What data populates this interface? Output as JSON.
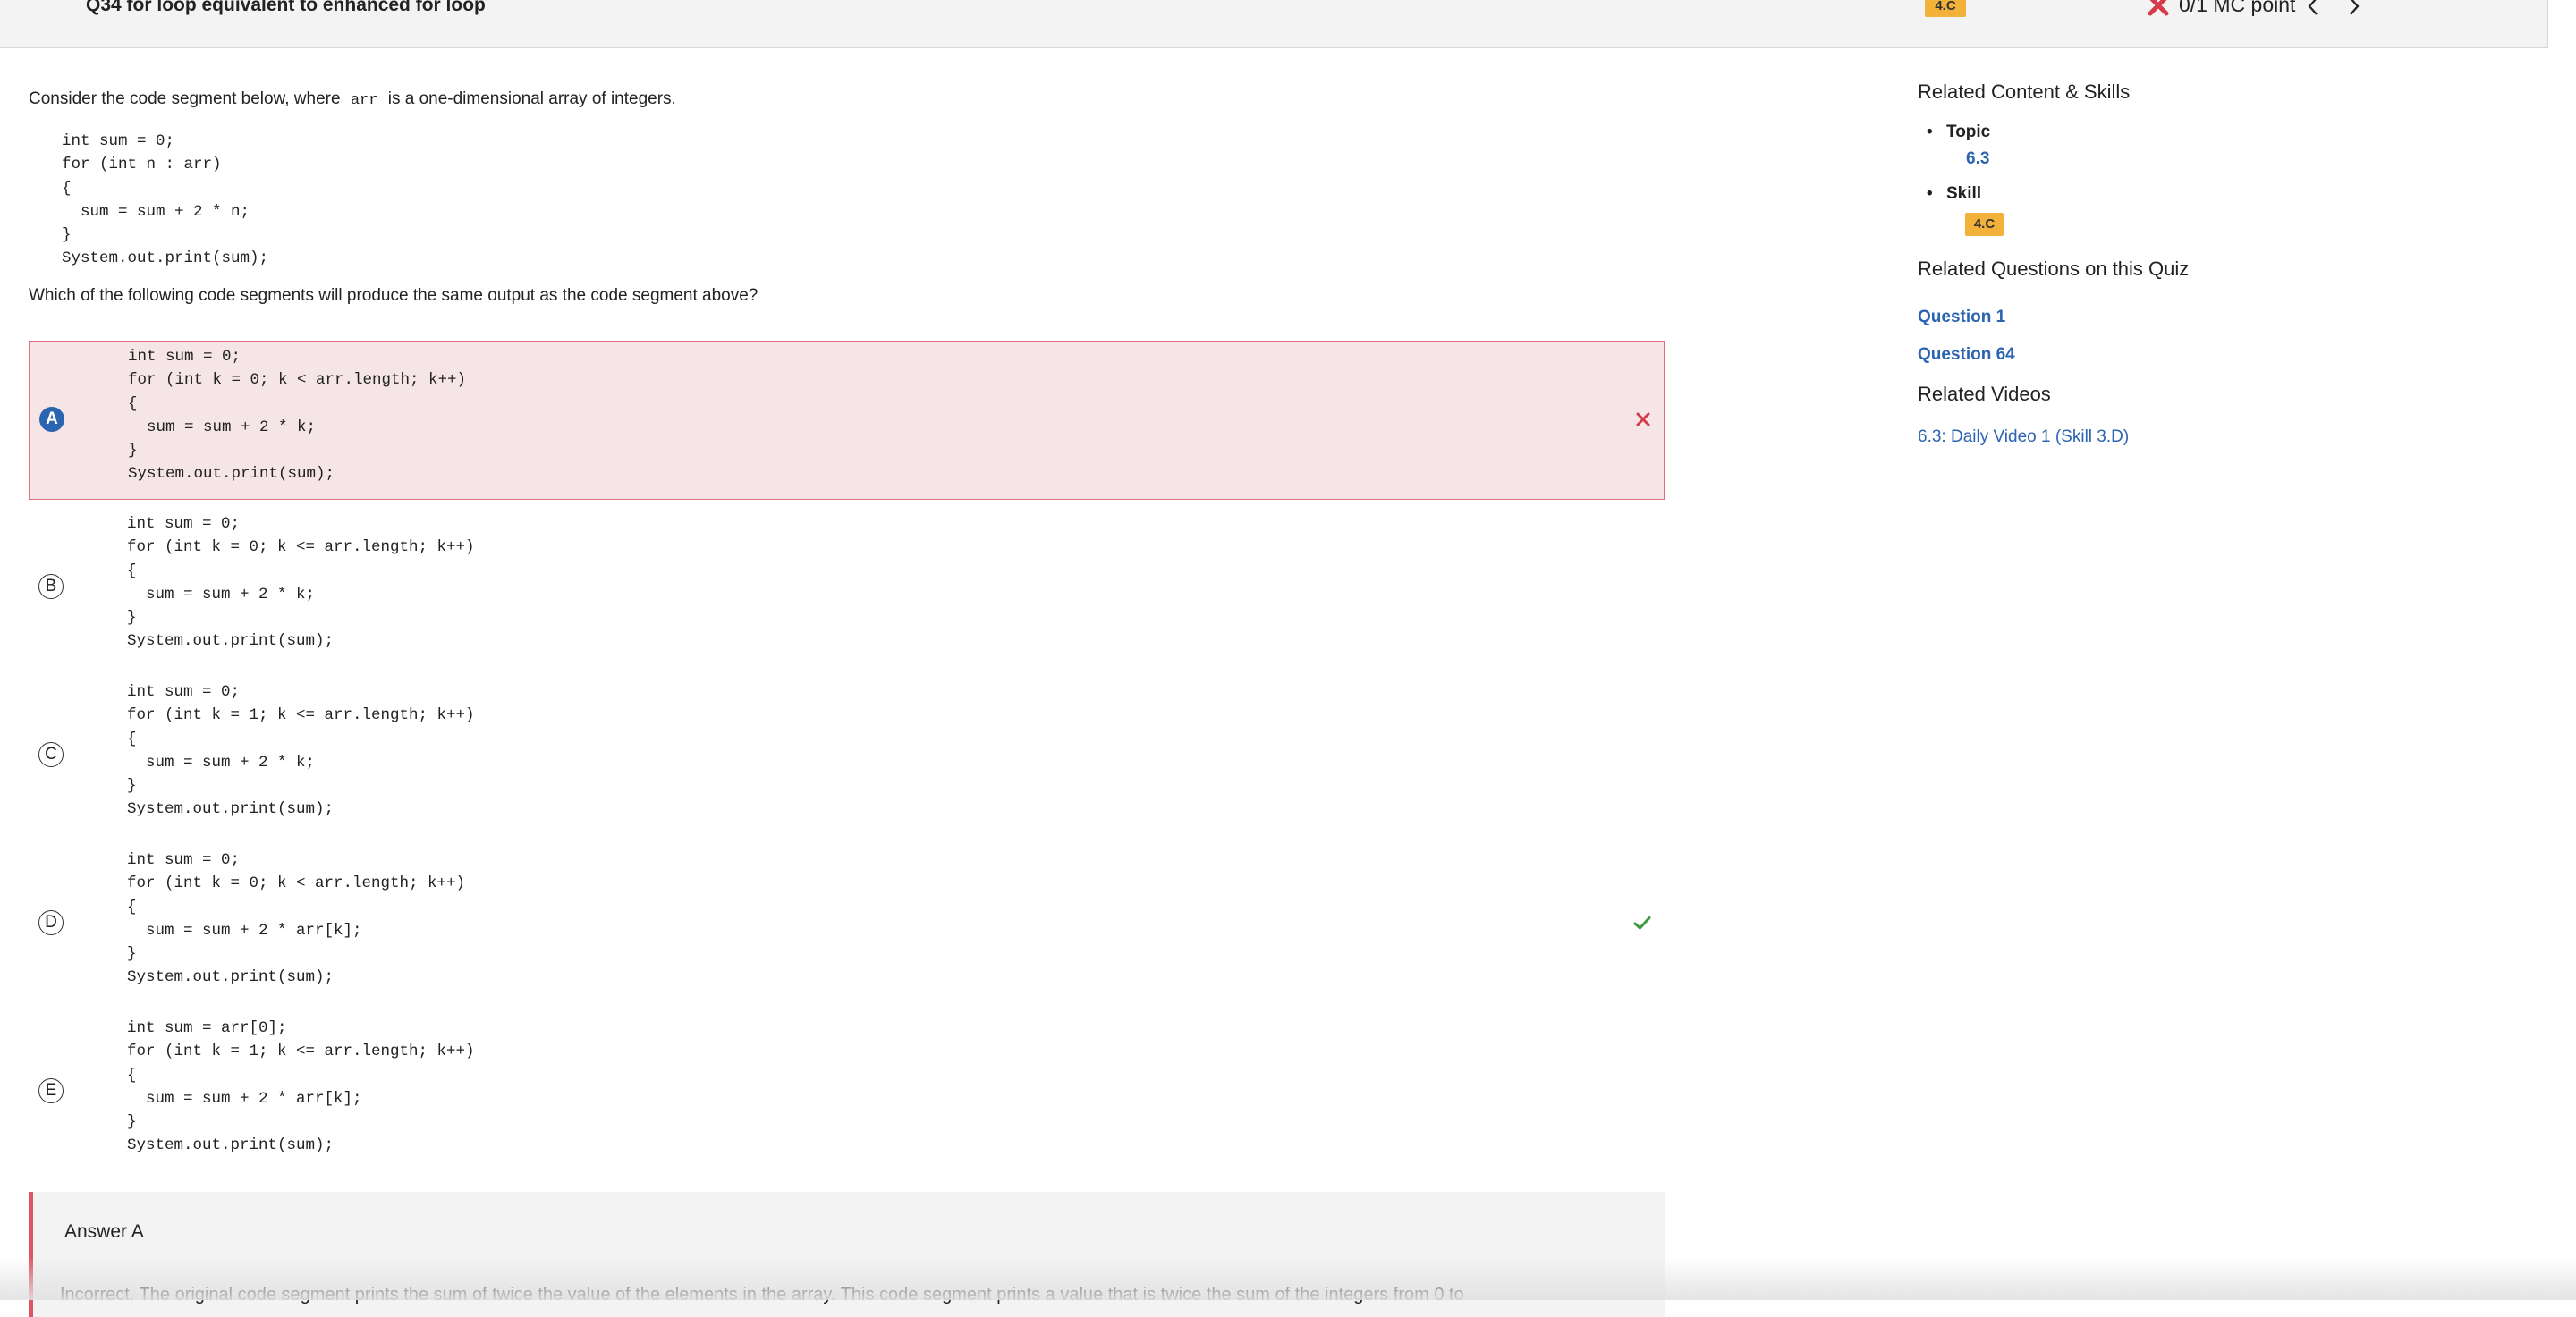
{
  "header": {
    "question_title": "Q34 for loop equivalent to enhanced for loop",
    "skill_badge": "4.C",
    "score_text": "0/1 MC point",
    "status_icon": "x-icon",
    "prev_icon": "chevron-left-icon",
    "next_icon": "chevron-right-icon",
    "incorrect_color": "#d93a4a"
  },
  "question": {
    "intro_before": "Consider the code segment below, where",
    "intro_code": "arr",
    "intro_after": "is a one-dimensional array of integers.",
    "code": "int sum = 0;\nfor (int n : arr)\n{\n  sum = sum + 2 * n;\n}\nSystem.out.print(sum);",
    "prompt": "Which of the following code segments will produce the same output as the code segment above?"
  },
  "choices": [
    {
      "letter": "A",
      "code": "int sum = 0;\nfor (int k = 0; k < arr.length; k++)\n{\n  sum = sum + 2 * k;\n}\nSystem.out.print(sum);",
      "state": "selected-incorrect"
    },
    {
      "letter": "B",
      "code": "int sum = 0;\nfor (int k = 0; k <= arr.length; k++)\n{\n  sum = sum + 2 * k;\n}\nSystem.out.print(sum);",
      "state": "none"
    },
    {
      "letter": "C",
      "code": "int sum = 0;\nfor (int k = 1; k <= arr.length; k++)\n{\n  sum = sum + 2 * k;\n}\nSystem.out.print(sum);",
      "state": "none"
    },
    {
      "letter": "D",
      "code": "int sum = 0;\nfor (int k = 0; k < arr.length; k++)\n{\n  sum = sum + 2 * arr[k];\n}\nSystem.out.print(sum);",
      "state": "correct"
    },
    {
      "letter": "E",
      "code": "int sum = arr[0];\nfor (int k = 1; k <= arr.length; k++)\n{\n  sum = sum + 2 * arr[k];\n}\nSystem.out.print(sum);",
      "state": "none"
    }
  ],
  "explanation": {
    "title": "Answer A",
    "text": "Incorrect. The original code segment prints the sum of twice the value of the elements in the array. This code segment prints a value that is twice the sum of the integers from 0 to"
  },
  "sidebar": {
    "related_heading": "Related Content & Skills",
    "topic_label": "Topic",
    "topic_value": "6.3",
    "skill_label": "Skill",
    "skill_value": "4.C",
    "questions_heading": "Related Questions on this Quiz",
    "questions": [
      "Question 1",
      "Question 64"
    ],
    "videos_heading": "Related Videos",
    "videos": [
      "6.3: Daily Video 1 (Skill 3.D)"
    ]
  }
}
